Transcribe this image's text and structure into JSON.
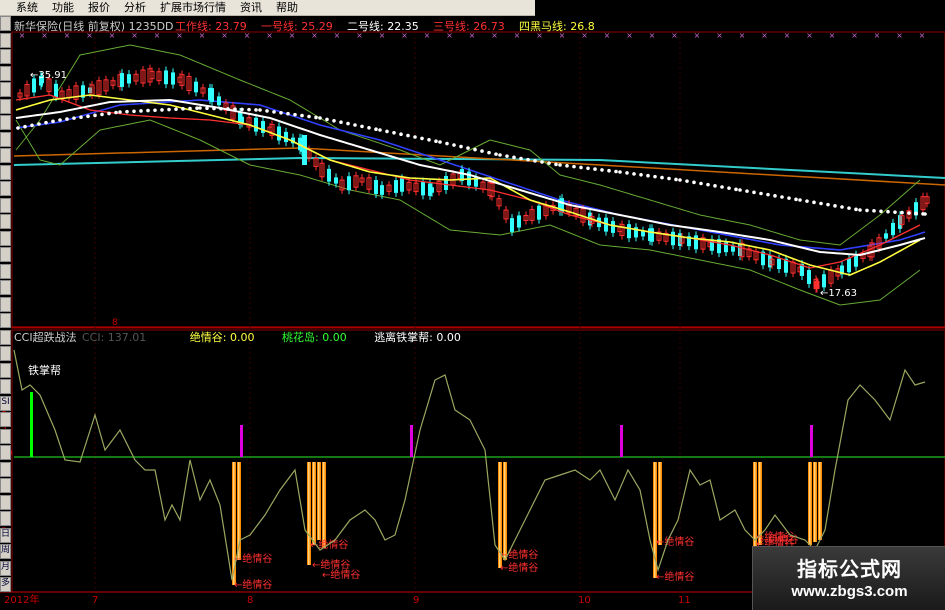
{
  "menu": [
    "系统",
    "功能",
    "报价",
    "分析",
    "扩展市场行情",
    "资讯",
    "帮助"
  ],
  "side_tabs": [
    "",
    "",
    "",
    "",
    "",
    "",
    "",
    "",
    "",
    "",
    "",
    "",
    "",
    "",
    "",
    "",
    "",
    "",
    "",
    "",
    "",
    "",
    "",
    "SI",
    "",
    "",
    "",
    "",
    "",
    "",
    "",
    "日",
    "周",
    "月",
    "多"
  ],
  "colors": {
    "background": "#000000",
    "grid_red": "#8b0000",
    "up_candle": "#ff3030",
    "down_candle": "#33ffff",
    "white_dots": "#ffffff",
    "ma_yellow": "#ffff40",
    "ma_white": "#ffffff",
    "ma_blue": "#3040ff",
    "ma_red": "#ff3030",
    "cyan_long": "#33cccc",
    "orange_long": "#cc6600",
    "band_green": "#66aa33",
    "cci_line": "#9aa860",
    "zero_line": "#20c020",
    "magenta_bar": "#dd00dd",
    "orange_bar": "#ff8c00",
    "green_bar": "#00ff00"
  },
  "upper_panel": {
    "title": "新华保险(日线 前复权) 1235DD",
    "indicators": [
      {
        "label": "工作线:",
        "value": "23.79",
        "color": "#ff3030"
      },
      {
        "label": "一号线:",
        "value": "25.29",
        "color": "#ff3030"
      },
      {
        "label": "二号线:",
        "value": "22.35",
        "color": "#ffffff"
      },
      {
        "label": "三号线:",
        "value": "26.73",
        "color": "#ff3030"
      },
      {
        "label": "四黑马线:",
        "value": "26.8",
        "color": "#ffff40"
      }
    ],
    "high_marker": "35.91",
    "low_marker": "17.63"
  },
  "lower_panel": {
    "title": "CCI超跌战法",
    "indicators": [
      {
        "label": "CCI:",
        "value": "137.01",
        "color": "#555555"
      },
      {
        "label": "绝情谷:",
        "value": "0.00",
        "color": "#ffff40"
      },
      {
        "label": "桃花岛:",
        "value": "0.00",
        "color": "#33ff33"
      },
      {
        "label": "逃离铁掌帮:",
        "value": "0.00",
        "color": "#ffffff"
      }
    ],
    "tiezhang_label": "铁掌帮",
    "jueqinggu_label": "绝情谷",
    "left_ticks": [
      "1",
      "5",
      "30",
      "0",
      "5",
      "0"
    ]
  },
  "time_axis": [
    "2012年",
    "7",
    "8",
    "9",
    "10",
    "11"
  ],
  "watermark": {
    "title": "指标公式网",
    "url": "www.zbgs3.com"
  }
}
